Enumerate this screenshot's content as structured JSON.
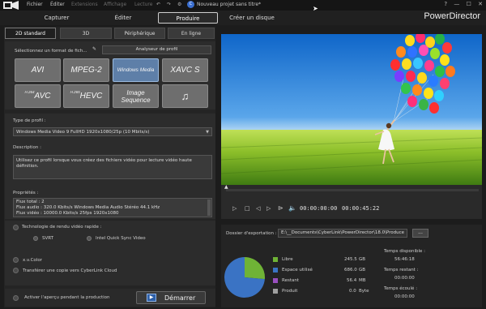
{
  "menu": {
    "items": [
      "Fichier",
      "Éditer",
      "Extensions",
      "Affichage",
      "Lecture"
    ],
    "project_name": "Nouveau projet sans titre*",
    "window_buttons": [
      "?",
      "—",
      "☐",
      "✕"
    ]
  },
  "modes": {
    "tabs": [
      "Capturer",
      "Éditer",
      "Produire",
      "Créer un disque"
    ],
    "active": "Produire",
    "brand": "PowerDirector"
  },
  "subtabs": {
    "items": [
      "2D standard",
      "3D",
      "Périphérique",
      "En ligne"
    ],
    "active": "2D standard"
  },
  "format": {
    "select_label": "Sélectionnez un format de fich...",
    "analyzer_label": "Analyseur de profil",
    "buttons": [
      {
        "label": "AVI",
        "selected": false
      },
      {
        "label": "MPEG-2",
        "selected": false
      },
      {
        "label": "Windows Media",
        "selected": true
      },
      {
        "label": "XAVC S",
        "selected": false
      },
      {
        "prefix": "H.264",
        "label": "AVC",
        "selected": false
      },
      {
        "prefix": "H.265",
        "label": "HEVC",
        "selected": false
      },
      {
        "label": "Image Sequence",
        "line1": "Image",
        "line2": "Sequence",
        "selected": false
      },
      {
        "label": "♫",
        "selected": false
      }
    ]
  },
  "profile": {
    "type_label": "Type de profil :",
    "type_value": "Windows Media Video 9 FullHD 1920x1080/25p (10 Mbits/s)",
    "description_label": "Description :",
    "description_text": "Utilisez ce profil lorsque vous créez des fichiers vidéo pour lecture vidéo haute définition.",
    "properties_label": "Propriétés :",
    "properties_lines": [
      "Flux total : 2",
      "Flux audio :  320.0 Kbits/s  Windows Media Audio  Stéréo  44.1 kHz",
      "Flux vidéo :  10000.0 Kbits/s  25fps   1920x1080"
    ]
  },
  "options": {
    "fast_render_label": "Technologie de rendu vidéo rapide :",
    "svrt_label": "SVRT",
    "intel_label": "Intel Quick Sync Video",
    "xvcolor_label": "x.v.Color",
    "cloud_label": "Transférer une copie vers CyberLink Cloud",
    "preview_label": "Activer l'aperçu pendant la production",
    "start_label": "Démarrer"
  },
  "player": {
    "time_current": "00:00:00:00",
    "time_total": "00:00:45:22"
  },
  "export": {
    "folder_label": "Dossier d'exportation :",
    "folder_path": "E:\\__Documents\\CyberLink\\PowerDirector\\18.0\\Produce",
    "browse_label": "...",
    "legend": [
      {
        "name": "Libre",
        "value": "245.5",
        "unit": "GB",
        "color": "#6fb336"
      },
      {
        "name": "Espace utilisé",
        "value": "686.0",
        "unit": "GB",
        "color": "#3a73c4"
      },
      {
        "name": "Restant",
        "value": "56.4",
        "unit": "MB",
        "color": "#9a4fc0"
      },
      {
        "name": "Produit",
        "value": "0.0",
        "unit": "Byte",
        "color": "#a0a0a0"
      }
    ],
    "pie_fractions": [
      0.2636,
      0.7364
    ],
    "time_available_label": "Temps disponible :",
    "time_available": "56:46:18",
    "time_remaining_label": "Temps restant :",
    "time_remaining": "00:00:00",
    "time_elapsed_label": "Temps écoulé :",
    "time_elapsed": "00:00:00"
  }
}
